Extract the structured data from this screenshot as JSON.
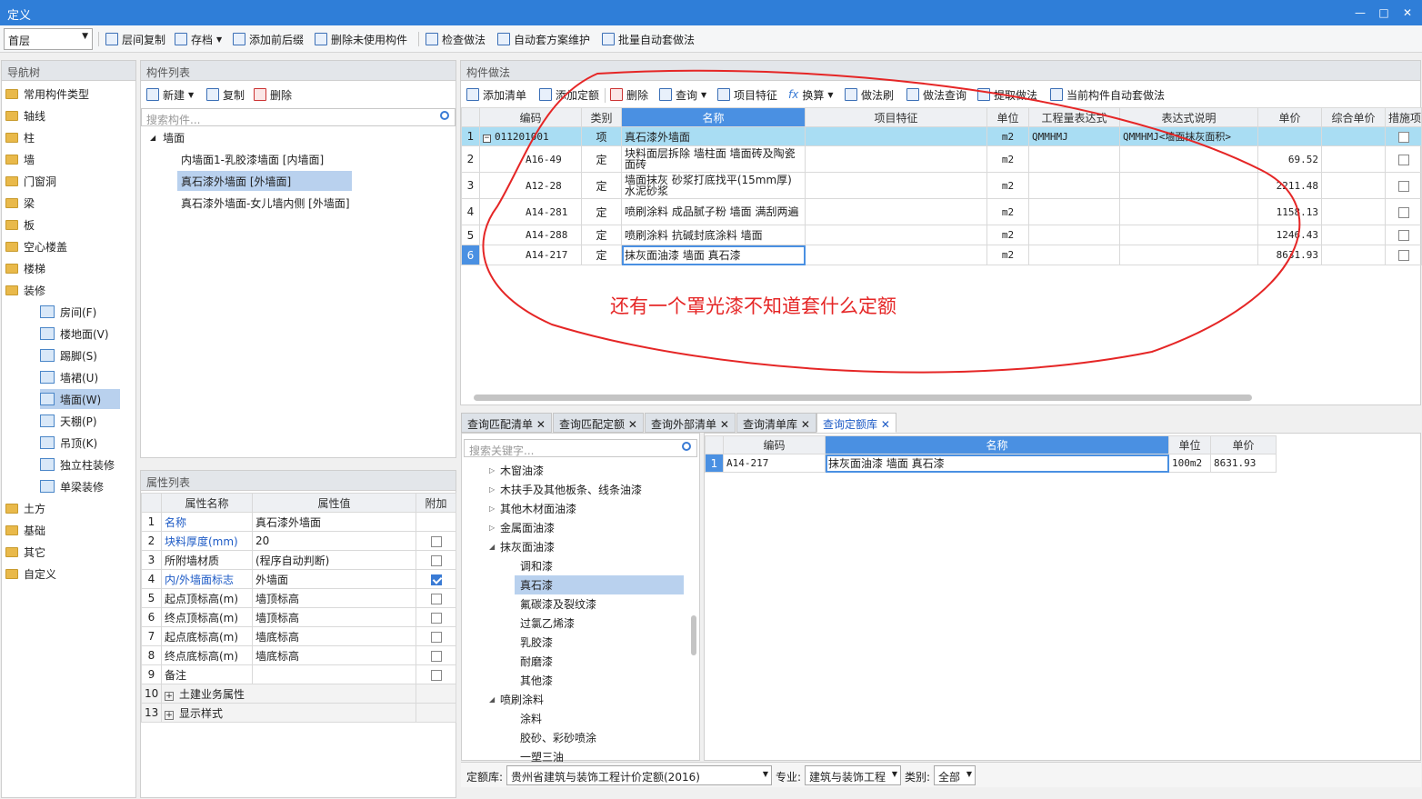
{
  "window": {
    "title": "定义"
  },
  "toolbar": {
    "floor": "首层",
    "buttons": [
      "层间复制",
      "存档",
      "添加前后缀",
      "删除未使用构件",
      "检查做法",
      "自动套方案维护",
      "批量自动套做法"
    ]
  },
  "nav": {
    "title": "导航树",
    "items": [
      "常用构件类型",
      "轴线",
      "柱",
      "墙",
      "门窗洞",
      "梁",
      "板",
      "空心楼盖",
      "楼梯",
      "装修"
    ],
    "sub_items": [
      "房间(F)",
      "楼地面(V)",
      "踢脚(S)",
      "墙裙(U)",
      "墙面(W)",
      "天棚(P)",
      "吊顶(K)",
      "独立柱装修",
      "单梁装修"
    ],
    "after_items": [
      "土方",
      "基础",
      "其它",
      "自定义"
    ]
  },
  "components": {
    "title": "构件列表",
    "new_label": "新建",
    "copy_label": "复制",
    "delete_label": "删除",
    "search_placeholder": "搜索构件...",
    "root": "墙面",
    "items": [
      "内墙面1-乳胶漆墙面 [内墙面]",
      "真石漆外墙面 [外墙面]",
      "真石漆外墙面-女儿墙内侧 [外墙面]"
    ]
  },
  "properties": {
    "title": "属性列表",
    "headers": [
      "属性名称",
      "属性值",
      "附加"
    ],
    "rows": [
      {
        "no": "1",
        "name": "名称",
        "value": "真石漆外墙面"
      },
      {
        "no": "2",
        "name": "块料厚度(mm)",
        "value": "20"
      },
      {
        "no": "3",
        "name": "所附墙材质",
        "value": "(程序自动判断)"
      },
      {
        "no": "4",
        "name": "内/外墙面标志",
        "value": "外墙面"
      },
      {
        "no": "5",
        "name": "起点顶标高(m)",
        "value": "墙顶标高"
      },
      {
        "no": "6",
        "name": "终点顶标高(m)",
        "value": "墙顶标高"
      },
      {
        "no": "7",
        "name": "起点底标高(m)",
        "value": "墙底标高"
      },
      {
        "no": "8",
        "name": "终点底标高(m)",
        "value": "墙底标高"
      },
      {
        "no": "9",
        "name": "备注",
        "value": ""
      },
      {
        "no": "10",
        "name": "土建业务属性",
        "value": ""
      },
      {
        "no": "13",
        "name": "显示样式",
        "value": ""
      }
    ]
  },
  "methods": {
    "title": "构件做法",
    "toolbar": [
      "添加清单",
      "添加定额",
      "删除",
      "查询",
      "项目特征",
      "换算",
      "做法刷",
      "做法查询",
      "提取做法",
      "当前构件自动套做法"
    ],
    "headers": [
      "编码",
      "类别",
      "名称",
      "项目特征",
      "单位",
      "工程量表达式",
      "表达式说明",
      "单价",
      "综合单价",
      "措施项"
    ],
    "rows": [
      {
        "no": "1",
        "code": "011201001",
        "type": "项",
        "name": "真石漆外墙面",
        "unit": "m2",
        "expr": "QMMHMJ",
        "desc": "QMMHMJ<墙面抹灰面积>",
        "price": ""
      },
      {
        "no": "2",
        "code": "A16-49",
        "type": "定",
        "name": "块料面层拆除 墙柱面 墙面砖及陶瓷面砖",
        "unit": "m2",
        "expr": "",
        "desc": "",
        "price": "69.52"
      },
      {
        "no": "3",
        "code": "A12-28",
        "type": "定",
        "name": "墙面抹灰 砂浆打底找平(15mm厚) 水泥砂浆",
        "unit": "m2",
        "expr": "",
        "desc": "",
        "price": "2211.48"
      },
      {
        "no": "4",
        "code": "A14-281",
        "type": "定",
        "name": "喷刷涂料 成品腻子粉 墙面 满刮两遍",
        "unit": "m2",
        "expr": "",
        "desc": "",
        "price": "1158.13"
      },
      {
        "no": "5",
        "code": "A14-288",
        "type": "定",
        "name": "喷刷涂料 抗碱封底涂料 墙面",
        "unit": "m2",
        "expr": "",
        "desc": "",
        "price": "1246.43"
      },
      {
        "no": "6",
        "code": "A14-217",
        "type": "定",
        "name": "抹灰面油漆 墙面 真石漆",
        "unit": "m2",
        "expr": "",
        "desc": "",
        "price": "8631.93"
      }
    ],
    "annotation": "还有一个罩光漆不知道套什么定额"
  },
  "query": {
    "tabs": [
      "查询匹配清单",
      "查询匹配定额",
      "查询外部清单",
      "查询清单库",
      "查询定额库"
    ],
    "search_placeholder": "搜索关键字...",
    "tree": [
      {
        "label": "木窗油漆",
        "level": 0,
        "arrow": "▷"
      },
      {
        "label": "木扶手及其他板条、线条油漆",
        "level": 0,
        "arrow": "▷"
      },
      {
        "label": "其他木材面油漆",
        "level": 0,
        "arrow": "▷"
      },
      {
        "label": "金属面油漆",
        "level": 0,
        "arrow": "▷"
      },
      {
        "label": "抹灰面油漆",
        "level": 0,
        "arrow": "◢"
      },
      {
        "label": "调和漆",
        "level": 1,
        "arrow": ""
      },
      {
        "label": "真石漆",
        "level": 1,
        "arrow": ""
      },
      {
        "label": "氟碳漆及裂纹漆",
        "level": 1,
        "arrow": ""
      },
      {
        "label": "过氯乙烯漆",
        "level": 1,
        "arrow": ""
      },
      {
        "label": "乳胶漆",
        "level": 1,
        "arrow": ""
      },
      {
        "label": "耐磨漆",
        "level": 1,
        "arrow": ""
      },
      {
        "label": "其他漆",
        "level": 1,
        "arrow": ""
      },
      {
        "label": "喷刷涂料",
        "level": 0,
        "arrow": "◢"
      },
      {
        "label": "涂料",
        "level": 1,
        "arrow": ""
      },
      {
        "label": "胶砂、彩砂喷涂",
        "level": 1,
        "arrow": ""
      },
      {
        "label": "一塑三油",
        "level": 1,
        "arrow": ""
      }
    ],
    "result_headers": [
      "编码",
      "名称",
      "单位",
      "单价"
    ],
    "result_rows": [
      {
        "no": "1",
        "code": "A14-217",
        "name": "抹灰面油漆 墙面 真石漆",
        "unit": "100m2",
        "price": "8631.93"
      }
    ],
    "footer": {
      "lib_label": "定额库:",
      "lib_value": "贵州省建筑与装饰工程计价定额(2016)",
      "major_label": "专业:",
      "major_value": "建筑与装饰工程",
      "cat_label": "类别:",
      "cat_value": "全部"
    }
  }
}
